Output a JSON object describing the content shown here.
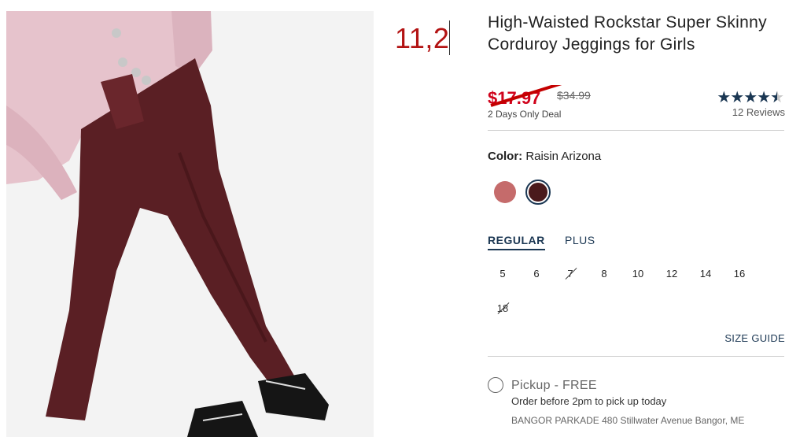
{
  "annotation": {
    "text": "11,2"
  },
  "product": {
    "title": "High-Waisted Rockstar Super Skinny Corduroy Jeggings for Girls",
    "sale_price": "$17.97",
    "original_price": "$34.99",
    "deal_label": "2 Days Only Deal",
    "rating": 4.5,
    "reviews_label": "12 Reviews"
  },
  "color": {
    "label": "Color:",
    "selected_name": "Raisin Arizona",
    "swatches": [
      {
        "name": "rose",
        "hex": "#c56b6b",
        "selected": false
      },
      {
        "name": "raisin",
        "hex": "#4a1a1c",
        "selected": true
      }
    ]
  },
  "fit_tabs": [
    {
      "label": "REGULAR",
      "active": true
    },
    {
      "label": "PLUS",
      "active": false
    }
  ],
  "sizes": [
    {
      "label": "5",
      "available": true
    },
    {
      "label": "6",
      "available": true
    },
    {
      "label": "7",
      "available": false
    },
    {
      "label": "8",
      "available": true
    },
    {
      "label": "10",
      "available": true
    },
    {
      "label": "12",
      "available": true
    },
    {
      "label": "14",
      "available": true
    },
    {
      "label": "16",
      "available": true
    },
    {
      "label": "18",
      "available": false
    }
  ],
  "size_guide_label": "SIZE GUIDE",
  "pickup": {
    "label": "Pickup - FREE",
    "subtext": "Order before 2pm to pick up today",
    "store": "BANGOR PARKADE 480 Stillwater Avenue Bangor, ME"
  },
  "colors": {
    "accent": "#1b3753",
    "sale": "#d0021b",
    "pants": "#5a1f24",
    "sweater": "#e8c7cf"
  }
}
